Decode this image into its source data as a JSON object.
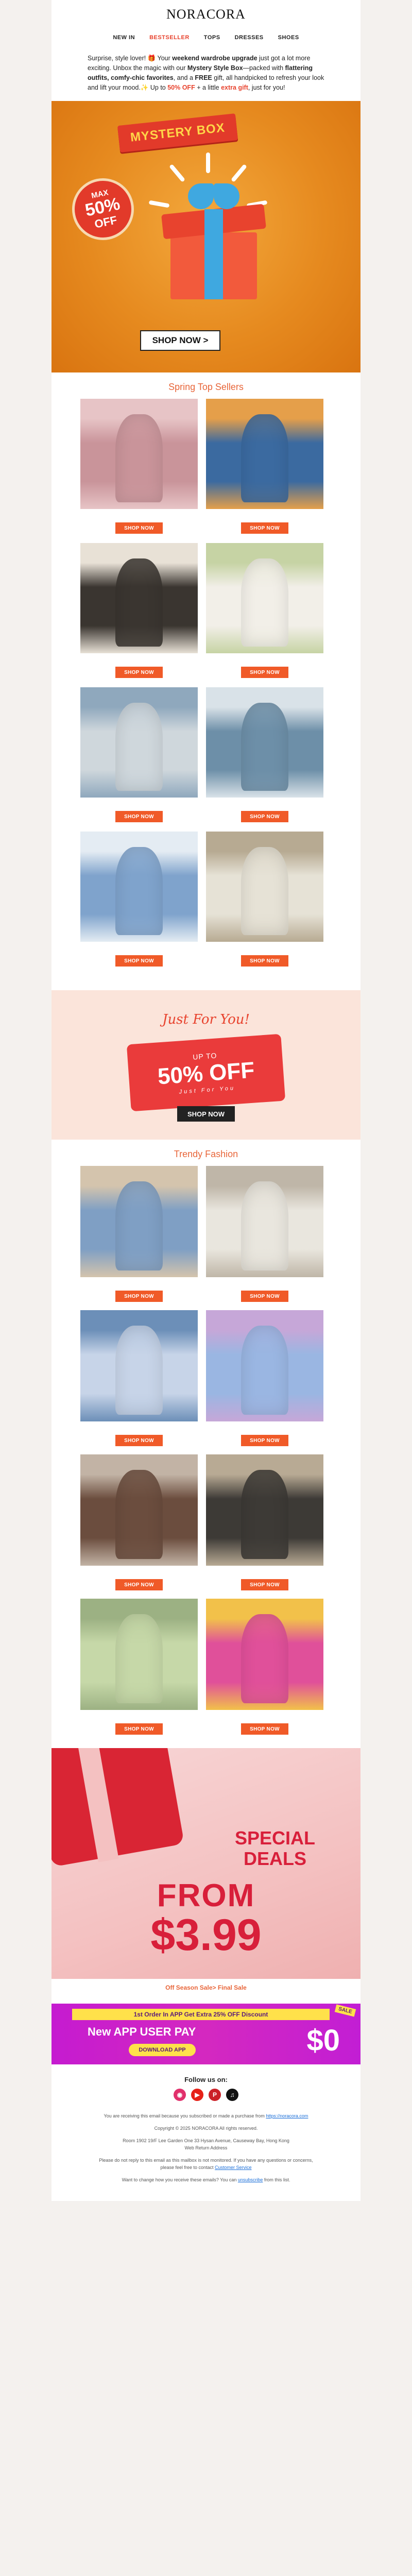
{
  "header": {
    "logo": "NORACORA",
    "nav": [
      "NEW IN",
      "BESTSELLER",
      "TOPS",
      "DRESSES",
      "SHOES"
    ]
  },
  "intro": {
    "p1": "Surprise, style lover! 🎁 Your ",
    "b1": "weekend wardrobe upgrade",
    "p2": " just got a lot more exciting. Unbox the magic with our ",
    "b2": "Mystery Style Box",
    "p3": "—packed with ",
    "b3": "flattering outfits, comfy-chic favorites",
    "p4": ", and a ",
    "b4": "FREE",
    "p5": " gift, all handpicked to refresh your look and lift your mood.✨ Up to ",
    "b5": "50% OFF",
    "p6": " + a little ",
    "b6": "extra gift",
    "p7": ", just for you!"
  },
  "mystery": {
    "banner": "MYSTERY BOX",
    "badge_top": "MAX",
    "badge_mid": "50%",
    "badge_bot": "OFF",
    "cta": "SHOP NOW >"
  },
  "spring": {
    "title": "Spring Top Sellers",
    "button": "SHOP NOW",
    "items": [
      {
        "colors": [
          "#c9949a",
          "#e7c4c6"
        ]
      },
      {
        "colors": [
          "#3b6aa0",
          "#e59f4a"
        ]
      },
      {
        "colors": [
          "#3a3530",
          "#e8e1d6"
        ]
      },
      {
        "colors": [
          "#f2efe8",
          "#c6d3a4"
        ]
      },
      {
        "colors": [
          "#cfd7dc",
          "#8fa8bd"
        ]
      },
      {
        "colors": [
          "#6d8fa8",
          "#d9e2e8"
        ]
      },
      {
        "colors": [
          "#7fa3cc",
          "#e4ecf3"
        ]
      },
      {
        "colors": [
          "#e6e2d6",
          "#b7aa92"
        ]
      }
    ]
  },
  "jfy": {
    "script": "Just For You!",
    "upto": "UP TO",
    "off": "50% OFF",
    "sub": "Just For You",
    "cta": "SHOP NOW"
  },
  "trendy": {
    "title": "Trendy Fashion",
    "button": "SHOP NOW",
    "items": [
      {
        "colors": [
          "#7f9fc4",
          "#d4c4ad"
        ]
      },
      {
        "colors": [
          "#e9e6de",
          "#bfb6a8"
        ]
      },
      {
        "colors": [
          "#c7d4e8",
          "#6c8fb8"
        ]
      },
      {
        "colors": [
          "#9ab6e2",
          "#c6a7d8"
        ]
      },
      {
        "colors": [
          "#6b4d3e",
          "#c2b3a5"
        ]
      },
      {
        "colors": [
          "#3d3a36",
          "#b8aa94"
        ]
      },
      {
        "colors": [
          "#c6d8a8",
          "#9cb183"
        ]
      },
      {
        "colors": [
          "#e0509a",
          "#f2c14a"
        ]
      }
    ]
  },
  "deals": {
    "line1": "SPECIAL",
    "line2": "DEALS",
    "from": "FROM",
    "price": "$3.99"
  },
  "offseason_link": "Off Season Sale> Final Sale",
  "app": {
    "strip": "1st Order In APP Get Extra 25% OFF Discount",
    "headline": "New APP USER PAY",
    "price": "$0",
    "button": "DOWNLOAD APP",
    "tag": "SALE"
  },
  "footer": {
    "follow": "Follow us on:",
    "social": [
      "instagram-icon",
      "youtube-icon",
      "pinterest-icon",
      "tiktok-icon"
    ],
    "p1": "You are receiving this email because you subscribed or made a purchase from ",
    "p1_link": "https://noracora.com",
    "copyright": "Copyright © 2025 NORACORA All rights reserved.",
    "address": "Room 1902 19/F Lee Garden One 33 Hysan Avenue, Causeway Bay, Hong Kong",
    "address2": "Web Return Address",
    "p2": "Please do not reply to this email as this mailbox is not monitored. If you have any questions or concerns, please feel free to contact ",
    "p2_link": "Customer Service",
    "p3": "Want to change how you receive these emails? You can ",
    "p3_link": "unsubscribe",
    "p3_end": " from this list."
  }
}
